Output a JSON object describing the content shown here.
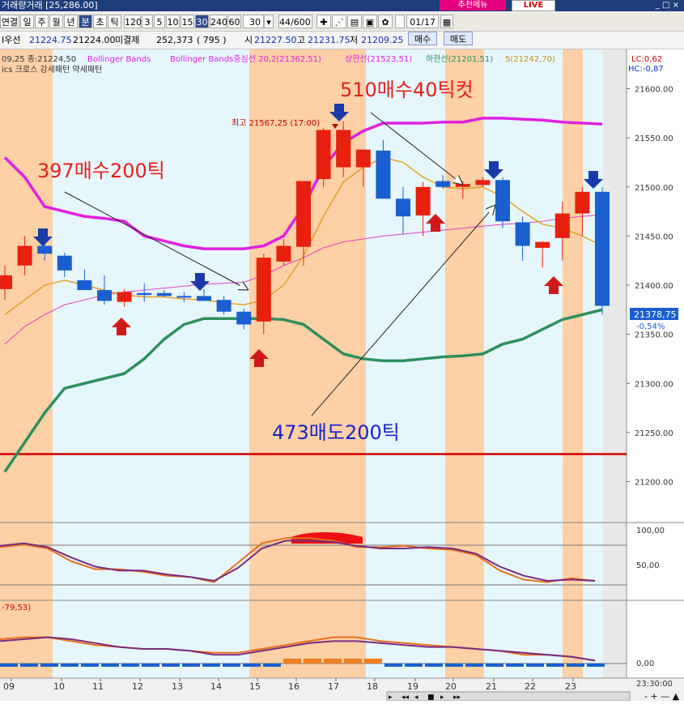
{
  "app": {
    "title": "거래량거래 [25,286.00]",
    "menu_button": "추천메뉴",
    "live_button": "LIVE",
    "window_controls": "_ □ ×"
  },
  "toolbar": {
    "period_buttons": [
      "연결",
      "일",
      "주",
      "월",
      "년",
      "분",
      "초",
      "틱"
    ],
    "active_period": "분",
    "interval_buttons": [
      "120",
      "3",
      "5",
      "10",
      "15",
      "30",
      "240",
      "60"
    ],
    "active_interval": "30",
    "count_value": "30",
    "range_value": "44/600",
    "date_value": "01/17",
    "icons": [
      "crosshair-icon",
      "draw-icon",
      "settings-icon",
      "save-icon",
      "gear-icon"
    ]
  },
  "quote_bar": {
    "label_prev": "I우선",
    "price1": "21224.75",
    "price2": "21224.00",
    "unfilled_label": "미결제",
    "unfilled_value": "252,373",
    "unfilled_change": "(   795   )",
    "open_label": "시",
    "open_value": "21227.50",
    "high_label": "고",
    "high_value": "21231.75",
    "low_label": "저",
    "low_value": "21209.25",
    "buy_button": "매수",
    "sell_button": "매도"
  },
  "chart_header": {
    "line1_prefix": "09,25 종:21224,50",
    "bb_label": "Bollinger Bands",
    "bb_label2": "Bollinger Bands중심선 20,2(21362,51)",
    "upper_label": "상한선(21523,51)",
    "lower_label": "하한선(21201,51)",
    "ma_label": "5(21242,70)",
    "line2": "ics 크로스 강세패턴  약세패턴",
    "lc_label": "LC:0,62",
    "hc_label": "HC:-0,87",
    "high_note": "최고 21567,25 (17:00)"
  },
  "annotations": {
    "note_397": "397매수200틱",
    "note_510": "510매수40틱컷",
    "note_473": "473매도200틱"
  },
  "price_box": {
    "value": "21378,75",
    "change": "-0,54%"
  },
  "osc1_labels": [
    "100,00",
    "50,00"
  ],
  "osc2_label": "-79,53)",
  "osc2_axis": [
    "0,00"
  ],
  "time_footer": "23:30:00",
  "colors": {
    "up": "#e8200e",
    "down": "#1a5fcf",
    "bb_upper": "#e020e0",
    "bb_lower": "#2f8f5f",
    "bb_mid": "#e040c0",
    "ma5": "#e8a020",
    "shade_orange": "#fdd0a6",
    "shade_blue": "#e6f6fd",
    "red_line": "#d40000",
    "annotation_red": "#e4201c",
    "annotation_blue": "#1a22c8"
  },
  "chart_data": {
    "type": "candlestick",
    "x_labels": [
      "09",
      "10",
      "11",
      "12",
      "13",
      "14",
      "15",
      "16",
      "17",
      "18",
      "19",
      "20",
      "21",
      "22",
      "23"
    ],
    "y_ticks": [
      21600,
      21550,
      21500,
      21450,
      21400,
      21350,
      21300,
      21250,
      21200
    ],
    "ylim": [
      21160,
      21640
    ],
    "candles": [
      {
        "o": 21396,
        "h": 21420,
        "l": 21385,
        "c": 21410
      },
      {
        "o": 21420,
        "h": 21450,
        "l": 21410,
        "c": 21440
      },
      {
        "o": 21440,
        "h": 21448,
        "l": 21425,
        "c": 21432
      },
      {
        "o": 21430,
        "h": 21433,
        "l": 21408,
        "c": 21415
      },
      {
        "o": 21405,
        "h": 21416,
        "l": 21397,
        "c": 21395
      },
      {
        "o": 21395,
        "h": 21410,
        "l": 21380,
        "c": 21384
      },
      {
        "o": 21383,
        "h": 21396,
        "l": 21378,
        "c": 21393
      },
      {
        "o": 21392,
        "h": 21402,
        "l": 21383,
        "c": 21390
      },
      {
        "o": 21392,
        "h": 21395,
        "l": 21388,
        "c": 21389
      },
      {
        "o": 21389,
        "h": 21393,
        "l": 21383,
        "c": 21388
      },
      {
        "o": 21389,
        "h": 21396,
        "l": 21385,
        "c": 21384
      },
      {
        "o": 21385,
        "h": 21389,
        "l": 21370,
        "c": 21373
      },
      {
        "o": 21373,
        "h": 21376,
        "l": 21355,
        "c": 21360
      },
      {
        "o": 21363,
        "h": 21432,
        "l": 21350,
        "c": 21428
      },
      {
        "o": 21424,
        "h": 21447,
        "l": 21420,
        "c": 21440
      },
      {
        "o": 21439,
        "h": 21505,
        "l": 21420,
        "c": 21506
      },
      {
        "o": 21508,
        "h": 21560,
        "l": 21500,
        "c": 21558
      },
      {
        "o": 21520,
        "h": 21567,
        "l": 21510,
        "c": 21558
      },
      {
        "o": 21520,
        "h": 21538,
        "l": 21500,
        "c": 21538
      },
      {
        "o": 21537,
        "h": 21548,
        "l": 21488,
        "c": 21488
      },
      {
        "o": 21488,
        "h": 21500,
        "l": 21452,
        "c": 21470
      },
      {
        "o": 21471,
        "h": 21505,
        "l": 21450,
        "c": 21500
      },
      {
        "o": 21506,
        "h": 21512,
        "l": 21498,
        "c": 21500
      },
      {
        "o": 21500,
        "h": 21506,
        "l": 21488,
        "c": 21503
      },
      {
        "o": 21502,
        "h": 21510,
        "l": 21500,
        "c": 21507
      },
      {
        "o": 21507,
        "h": 21510,
        "l": 21458,
        "c": 21465
      },
      {
        "o": 21464,
        "h": 21470,
        "l": 21425,
        "c": 21440
      },
      {
        "o": 21438,
        "h": 21445,
        "l": 21418,
        "c": 21444
      },
      {
        "o": 21448,
        "h": 21485,
        "l": 21425,
        "c": 21473
      },
      {
        "o": 21473,
        "h": 21500,
        "l": 21450,
        "c": 21495
      },
      {
        "o": 21495,
        "h": 21500,
        "l": 21370,
        "c": 21379
      }
    ],
    "bb_upper": [
      21530,
      21510,
      21480,
      21475,
      21470,
      21468,
      21465,
      21450,
      21445,
      21440,
      21437,
      21437,
      21437,
      21440,
      21450,
      21480,
      21520,
      21545,
      21557,
      21565,
      21565,
      21565,
      21566,
      21566,
      21570,
      21570,
      21569,
      21568,
      21566,
      21565,
      21564
    ],
    "bb_lower": [
      21210,
      21240,
      21270,
      21295,
      21300,
      21305,
      21310,
      21325,
      21345,
      21360,
      21366,
      21366,
      21366,
      21366,
      21365,
      21360,
      21345,
      21330,
      21325,
      21323,
      21323,
      21325,
      21327,
      21328,
      21330,
      21340,
      21345,
      21355,
      21365,
      21370,
      21375
    ],
    "bb_mid": [
      21340,
      21358,
      21370,
      21380,
      21385,
      21390,
      21393,
      21395,
      21397,
      21399,
      21401,
      21402,
      21403,
      21410,
      21420,
      21428,
      21438,
      21444,
      21447,
      21450,
      21452,
      21454,
      21456,
      21458,
      21460,
      21462,
      21463,
      21465,
      21468,
      21470,
      21472
    ],
    "ma5": [
      21370,
      21385,
      21400,
      21405,
      21400,
      21395,
      21390,
      21388,
      21388,
      21386,
      21385,
      21382,
      21380,
      21385,
      21400,
      21430,
      21470,
      21505,
      21520,
      21530,
      21525,
      21510,
      21500,
      21498,
      21500,
      21490,
      21475,
      21462,
      21458,
      21450,
      21440
    ],
    "osc1": {
      "ylim": [
        0,
        120
      ],
      "orange": [
        82,
        86,
        80,
        60,
        48,
        48,
        44,
        38,
        36,
        28,
        58,
        88,
        96,
        96,
        92,
        82,
        82,
        84,
        80,
        78,
        70,
        46,
        32,
        28,
        34,
        30
      ],
      "purple": [
        84,
        88,
        82,
        66,
        52,
        46,
        46,
        40,
        36,
        30,
        50,
        80,
        92,
        92,
        90,
        84,
        80,
        80,
        82,
        80,
        72,
        52,
        38,
        30,
        32,
        30
      ]
    },
    "osc2": {
      "ylim": [
        -20,
        60
      ],
      "orange": [
        20,
        22,
        22,
        18,
        14,
        12,
        10,
        10,
        8,
        6,
        6,
        10,
        14,
        18,
        22,
        22,
        18,
        16,
        14,
        12,
        10,
        8,
        4,
        4,
        2,
        -2
      ],
      "purple": [
        18,
        20,
        22,
        20,
        16,
        12,
        10,
        10,
        8,
        4,
        4,
        8,
        12,
        16,
        18,
        18,
        16,
        14,
        12,
        12,
        10,
        8,
        6,
        4,
        2,
        -2
      ]
    }
  }
}
